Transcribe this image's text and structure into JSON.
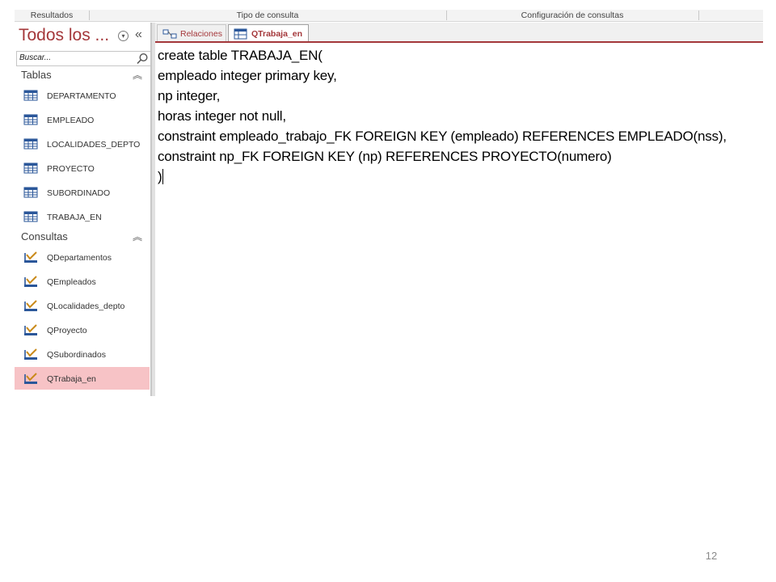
{
  "ribbon": {
    "groups": [
      "Resultados",
      "Tipo de consulta",
      "Configuración de consultas"
    ]
  },
  "nav": {
    "title": "Todos los ...",
    "search_placeholder": "Buscar...",
    "tables_header": "Tablas",
    "tables": [
      "DEPARTAMENTO",
      "EMPLEADO",
      "LOCALIDADES_DEPTO",
      "PROYECTO",
      "SUBORDINADO",
      "TRABAJA_EN"
    ],
    "queries_header": "Consultas",
    "queries": [
      "QDepartamentos",
      "QEmpleados",
      "QLocalidades_depto",
      "QProyecto",
      "QSubordinados",
      "QTrabaja_en"
    ],
    "selected_query": "QTrabaja_en"
  },
  "tabs": [
    {
      "label": "Relaciones",
      "icon": "relationships-icon",
      "active": false
    },
    {
      "label": "QTrabaja_en",
      "icon": "sql-query-icon",
      "active": true
    }
  ],
  "editor": {
    "lines": [
      "create table TRABAJA_EN(",
      "empleado integer primary key,",
      "np integer,",
      "horas integer not null,",
      "constraint empleado_trabajo_FK FOREIGN KEY (empleado) REFERENCES EMPLEADO(nss),",
      "constraint np_FK FOREIGN KEY (np) REFERENCES PROYECTO(numero)",
      ")"
    ]
  },
  "slide": {
    "page_number": "12"
  },
  "colors": {
    "accent": "#a4373a",
    "selected": "#f7c3c6",
    "table_icon": "#2b579a"
  }
}
